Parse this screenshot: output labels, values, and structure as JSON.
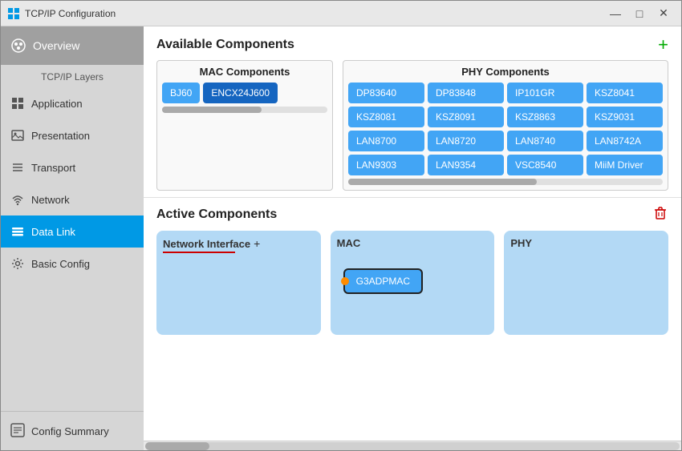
{
  "window": {
    "title": "TCP/IP Configuration",
    "controls": [
      "minimize",
      "maximize",
      "close"
    ]
  },
  "sidebar": {
    "overview_label": "Overview",
    "layers_label": "TCP/IP Layers",
    "nav_items": [
      {
        "id": "application",
        "label": "Application",
        "icon": "grid-icon"
      },
      {
        "id": "presentation",
        "label": "Presentation",
        "icon": "image-icon"
      },
      {
        "id": "transport",
        "label": "Transport",
        "icon": "bars-icon"
      },
      {
        "id": "network",
        "label": "Network",
        "icon": "wifi-icon"
      },
      {
        "id": "data-link",
        "label": "Data Link",
        "icon": "list-icon",
        "active": true
      },
      {
        "id": "basic-config",
        "label": "Basic Config",
        "icon": "gear-icon"
      }
    ],
    "config_summary_label": "Config Summary"
  },
  "available_components": {
    "title": "Available Components",
    "add_label": "+",
    "mac_group": {
      "title": "MAC Components",
      "chips": [
        "BJ60",
        "ENCX24J600"
      ]
    },
    "phy_group": {
      "title": "PHY Components",
      "chips": [
        "DP83640",
        "DP83848",
        "IP101GR",
        "KSZ8041",
        "KSZ8081",
        "KSZ8091",
        "KSZ8863",
        "KSZ9031",
        "LAN8700",
        "LAN8720",
        "LAN8740",
        "LAN8742A",
        "LAN9303",
        "LAN9354",
        "VSC8540",
        "MiiM Driver"
      ]
    }
  },
  "active_components": {
    "title": "Active Components",
    "delete_icon": "🗑",
    "groups": [
      {
        "id": "network-interface",
        "title": "Network Interface",
        "add_icon": "+",
        "chips": []
      },
      {
        "id": "mac",
        "title": "MAC",
        "chips": [
          "G3ADPMAC"
        ]
      },
      {
        "id": "phy",
        "title": "PHY",
        "chips": []
      }
    ]
  }
}
